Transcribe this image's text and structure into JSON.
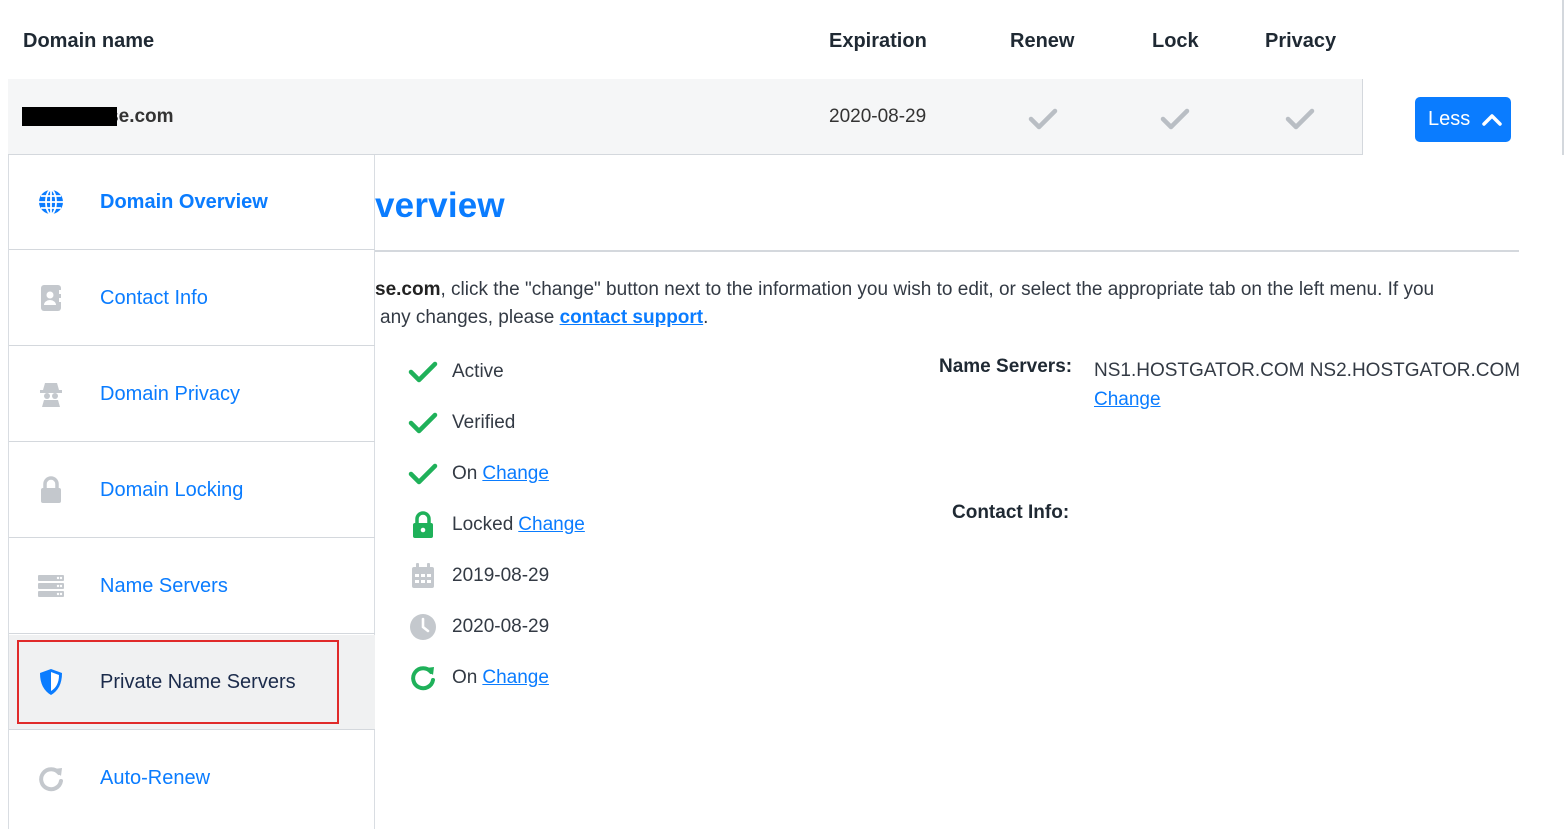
{
  "table": {
    "headers": {
      "domain_name": "Domain name",
      "expiration": "Expiration",
      "renew": "Renew",
      "lock": "Lock",
      "privacy": "Privacy"
    },
    "row": {
      "domain_visible_suffix": "se.com",
      "expiration": "2020-08-29",
      "renew_icon": "checkmark-icon",
      "lock_icon": "checkmark-icon",
      "privacy_icon": "checkmark-icon"
    },
    "less_button": {
      "label": "Less",
      "icon": "chevron-up-icon"
    }
  },
  "sidebar": {
    "items": [
      {
        "label": "Domain Overview",
        "icon": "globe-icon",
        "state": "active"
      },
      {
        "label": "Contact Info",
        "icon": "address-book-icon"
      },
      {
        "label": "Domain Privacy",
        "icon": "spy-icon"
      },
      {
        "label": "Domain Locking",
        "icon": "lock-icon"
      },
      {
        "label": "Name Servers",
        "icon": "server-icon"
      },
      {
        "label": "Private Name Servers",
        "icon": "shield-icon",
        "state": "highlighted"
      },
      {
        "label": "Auto-Renew",
        "icon": "refresh-icon"
      }
    ]
  },
  "main": {
    "title": "verview",
    "intro": {
      "domain_part": "se.com",
      "text_1": ", click the \"change\" button next to the information you wish to edit, or select the appropriate tab on the left menu. If you",
      "text_2": "any changes, please ",
      "link": "contact support",
      "text_3": "."
    },
    "status": [
      {
        "icon": "check-icon",
        "text": "Active",
        "link": ""
      },
      {
        "icon": "check-icon",
        "text": "Verified",
        "link": ""
      },
      {
        "icon": "check-icon",
        "text": "On",
        "link": "Change"
      },
      {
        "icon": "lock-icon",
        "text": "Locked",
        "link": "Change"
      },
      {
        "icon": "calendar-icon",
        "text": "2019-08-29",
        "link": ""
      },
      {
        "icon": "clock-icon",
        "text": "2020-08-29",
        "link": ""
      },
      {
        "icon": "refresh-icon",
        "text": "On",
        "link": "Change"
      }
    ],
    "name_servers": {
      "label": "Name Servers:",
      "value": "NS1.HOSTGATOR.COM NS2.HOSTGATOR.COM",
      "link": "Change"
    },
    "contact_info": {
      "label": "Contact Info:"
    }
  },
  "colors": {
    "accent": "#0a7cff",
    "success": "#1fb15a",
    "highlight_border": "#e02a2a",
    "muted_icon": "#c4c8cd"
  }
}
